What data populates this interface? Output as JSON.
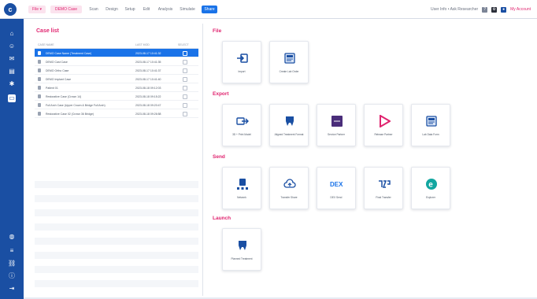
{
  "app": {
    "logo": "c"
  },
  "topbar": {
    "tabs": [
      {
        "label": "File ▾",
        "style": "pink"
      },
      {
        "label": "DEMO Case",
        "style": "pink"
      },
      {
        "label": "Scan",
        "style": "plain"
      },
      {
        "label": "Design",
        "style": "plain"
      },
      {
        "label": "Setup",
        "style": "plain"
      },
      {
        "label": "Edit",
        "style": "plain"
      },
      {
        "label": "Analysis",
        "style": "plain"
      },
      {
        "label": "Simulate",
        "style": "plain"
      },
      {
        "label": "Share",
        "style": "active"
      }
    ],
    "user_text": "User Info • Ask Researcher",
    "account_label": "My Account"
  },
  "sidebar": {
    "icons": [
      "home-icon",
      "user-icon",
      "message-icon",
      "document-icon",
      "settings-icon",
      "monitor-icon"
    ],
    "bottom_icons": [
      "globe-icon",
      "layers-icon",
      "link-icon",
      "info-icon",
      "logout-icon"
    ]
  },
  "case_list": {
    "title": "Case list",
    "columns": [
      "CASE NAME",
      "LAST MOD",
      "SELECT"
    ],
    "rows": [
      {
        "name": "DEMO Case Name (Treatment Case)",
        "date": "2023-08-17 10:41:32",
        "selected": true
      },
      {
        "name": "DEMO Cast Case",
        "date": "2023-08-17 10:41:35",
        "selected": false
      },
      {
        "name": "DEMO Ortho Case",
        "date": "2023-08-17 10:41:37",
        "selected": false
      },
      {
        "name": "DEMO Implant Case",
        "date": "2023-08-17 10:41:40",
        "selected": false
      },
      {
        "name": "Patient 01",
        "date": "2023-08-18 09:12:03",
        "selected": false
      },
      {
        "name": "Restorative Case (Crown 14)",
        "date": "2023-08-18 09:15:22",
        "selected": false
      },
      {
        "name": "Full Arch Case (Upper Crown & Bridge Full Arch)",
        "date": "2023-08-18 09:20:47",
        "selected": false
      },
      {
        "name": "Restorative Case 02 (Crown 36 Bridge)",
        "date": "2023-08-18 09:26:58",
        "selected": false
      }
    ]
  },
  "sections": {
    "file": {
      "title": "File",
      "tiles": [
        {
          "label": "Import",
          "icon": "import-icon",
          "color": "#1a4fa3"
        },
        {
          "label": "Create Lab Order",
          "icon": "lab-order-icon",
          "color": "#1a4fa3"
        }
      ]
    },
    "export": {
      "title": "Export",
      "tiles": [
        {
          "label": "3D + Print Model",
          "icon": "export-model-icon",
          "color": "#1a4fa3"
        },
        {
          "label": "Aligned Treatment Format",
          "icon": "tooth-export-icon",
          "color": "#1a4fa3"
        },
        {
          "label": "Service Partner",
          "icon": "service-partner-icon",
          "color": "#4a2d7a"
        },
        {
          "label": "Release Partner",
          "icon": "play-triangle-icon",
          "color": "#e0246f"
        },
        {
          "label": "Lab Data Form",
          "icon": "lab-data-icon",
          "color": "#1a4fa3"
        }
      ]
    },
    "send": {
      "title": "Send",
      "tiles": [
        {
          "label": "Network",
          "icon": "network-icon",
          "color": "#1a4fa3"
        },
        {
          "label": "Transfer Share",
          "icon": "cloud-upload-icon",
          "color": "#1a4fa3"
        },
        {
          "label": "DEX Send",
          "icon": "dex-icon",
          "color": "#1a73e8"
        },
        {
          "label": "Final Transfer",
          "icon": "transfer-icon",
          "color": "#1a4fa3"
        },
        {
          "label": "Explorer",
          "icon": "explorer-icon",
          "color": "#12a6a0"
        }
      ]
    },
    "launch": {
      "title": "Launch",
      "tiles": [
        {
          "label": "Planned Treatment",
          "icon": "tooth-launch-icon",
          "color": "#1a4fa3"
        }
      ]
    }
  }
}
